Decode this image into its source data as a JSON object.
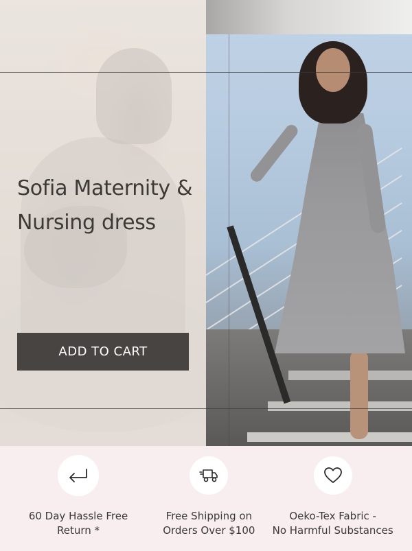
{
  "hero": {
    "title": "Sofia Maternity & Nursing dress",
    "cta_label": "ADD TO CART"
  },
  "features": [
    {
      "icon": "return-arrow-icon",
      "label": "60 Day Hassle Free\nReturn *"
    },
    {
      "icon": "delivery-truck-icon",
      "label": "Free Shipping on\nOrders Over $100"
    },
    {
      "icon": "heart-icon",
      "label": "Oeko-Tex Fabric -\nNo Harmful Substances"
    }
  ],
  "colors": {
    "cta_background": "#474441",
    "feature_background": "#f9eeef",
    "title_text": "#3d3a36"
  }
}
